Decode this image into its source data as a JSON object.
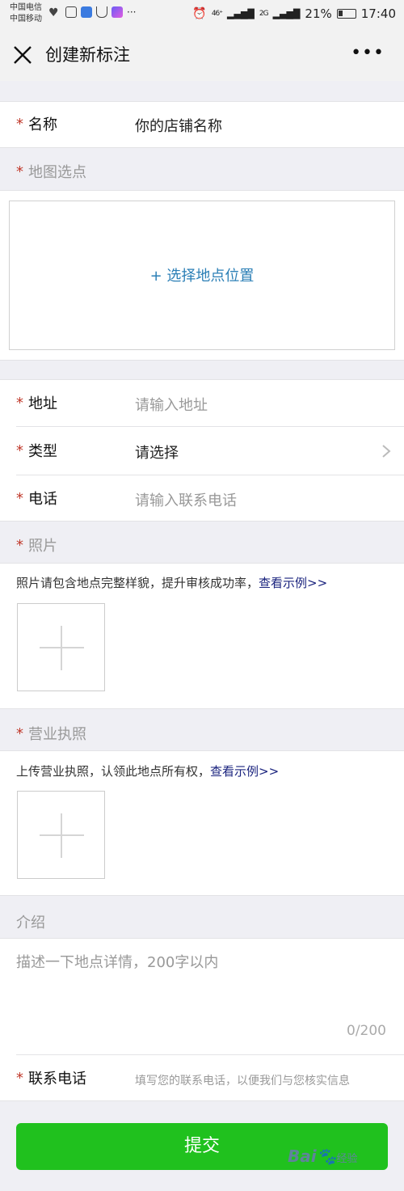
{
  "status_bar": {
    "carrier_1": "中国电信",
    "carrier_2": "中国移动",
    "signal_1": "46⁺",
    "signal_2": "2G",
    "battery": "21%",
    "time": "17:40",
    "dots": "···"
  },
  "navbar": {
    "title": "创建新标注",
    "more": "•••"
  },
  "form": {
    "name": {
      "label": "名称",
      "value": "你的店铺名称"
    },
    "map": {
      "label": "地图选点",
      "action": "+ 选择地点位置"
    },
    "address": {
      "label": "地址",
      "placeholder": "请输入地址"
    },
    "type": {
      "label": "类型",
      "value": "请选择"
    },
    "phone": {
      "label": "电话",
      "placeholder": "请输入联系电话"
    },
    "photos": {
      "label": "照片",
      "hint": "照片请包含地点完整样貌，提升审核成功率，",
      "link": "查看示例>>"
    },
    "license": {
      "label": "营业执照",
      "hint": "上传营业执照，认领此地点所有权，",
      "link": "查看示例>>"
    },
    "intro": {
      "label": "介绍",
      "placeholder": "描述一下地点详情，200字以内",
      "counter": "0/200"
    },
    "contact": {
      "label": "联系电话",
      "placeholder": "填写您的联系电话，以便我们与您核实信息"
    },
    "required_mark": "*"
  },
  "submit_label": "提交",
  "watermark": {
    "brand": "Bai",
    "suffix": "经验"
  },
  "colors": {
    "accent": "#20c11e",
    "required": "#c0392b",
    "link": "#2b7fb6"
  }
}
